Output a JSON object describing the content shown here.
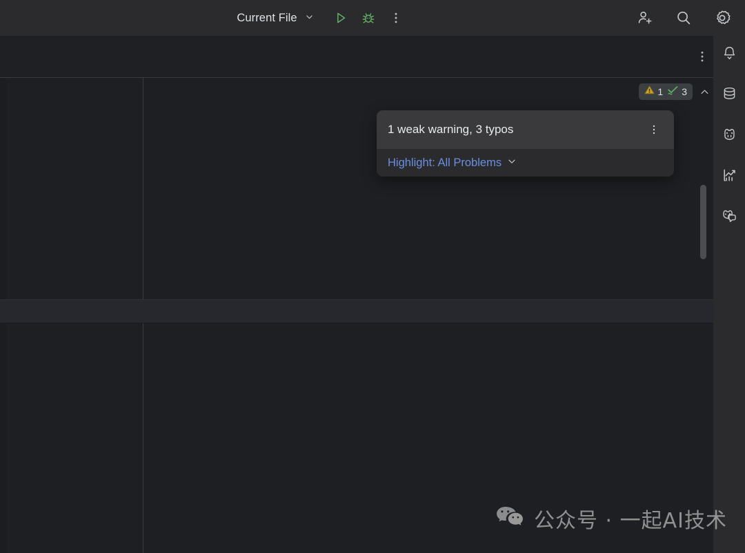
{
  "colors": {
    "toolbar_bg": "#2b2b2d",
    "editor_bg": "#1e1f22",
    "divider": "#393b40",
    "run_green": "#5fad65",
    "warning_yellow": "#c9a227",
    "typo_green": "#5fad65",
    "link_blue": "#6a8fe0",
    "text_primary": "#dfe1e5"
  },
  "toolbar": {
    "run_config_label": "Current File",
    "run_config_chevron": "chevron-down-icon",
    "run_button": "run-icon",
    "debug_button": "debug-icon",
    "more_button": "more-vertical-icon",
    "add_user_button": "add-user-icon",
    "search_button": "search-icon",
    "settings_button": "gear-icon"
  },
  "subbar": {
    "more_button": "more-vertical-icon"
  },
  "inspection": {
    "warning_count": "1",
    "warning_icon": "warning-triangle-icon",
    "typo_count": "3",
    "typo_icon": "check-squiggle-icon",
    "prev_button": "chevron-up-icon",
    "next_button": "chevron-down-icon"
  },
  "popup": {
    "title": "1 weak warning, 3 typos",
    "menu_button": "more-vertical-icon",
    "highlight_label": "Highlight: All Problems",
    "highlight_chevron": "chevron-down-icon"
  },
  "right_rail": {
    "items": [
      {
        "name": "notifications",
        "icon": "bell-icon"
      },
      {
        "name": "database",
        "icon": "database-icon"
      },
      {
        "name": "ai-assistant",
        "icon": "ai-face-icon"
      },
      {
        "name": "profiler",
        "icon": "chart-trend-icon"
      },
      {
        "name": "ai-chat",
        "icon": "ai-chat-icon"
      }
    ]
  },
  "watermark": {
    "icon": "wechat-icon",
    "text": "公众号 · 一起AI技术"
  }
}
